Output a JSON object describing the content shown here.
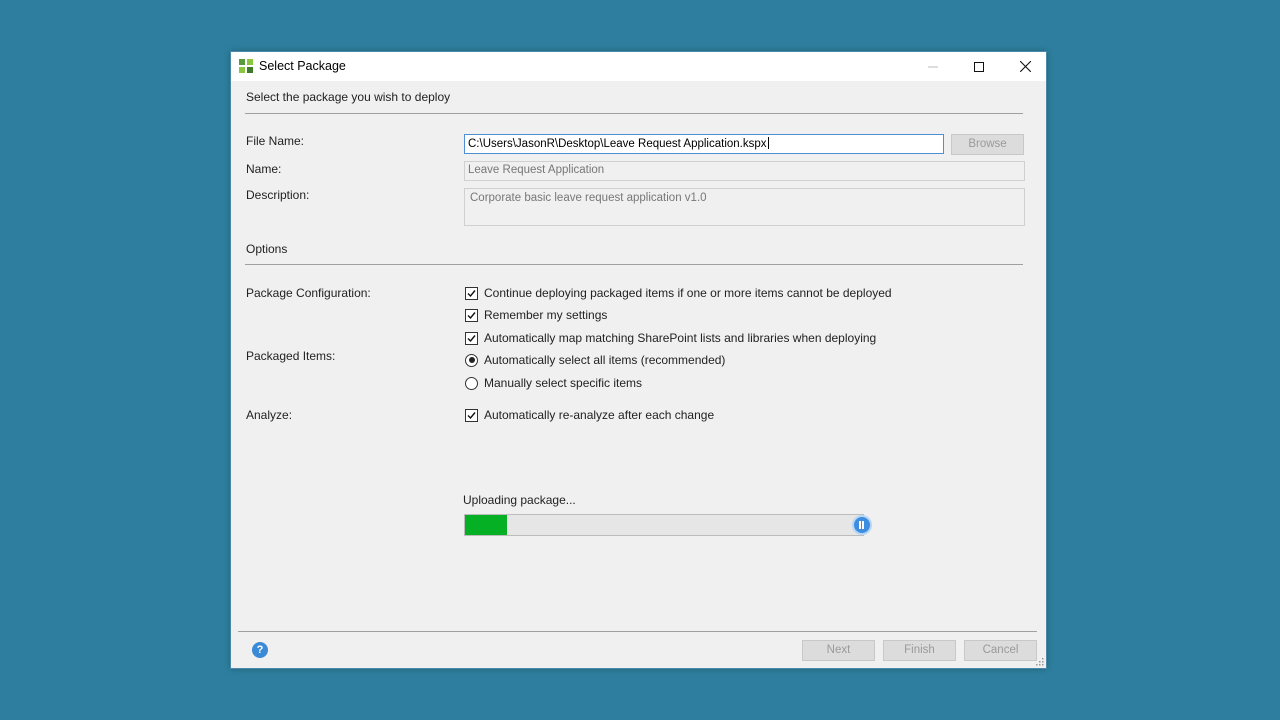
{
  "window": {
    "title": "Select Package"
  },
  "header": {
    "subtitle": "Select the package you wish to deploy"
  },
  "form": {
    "file_name_label": "File Name:",
    "file_name_value": "C:\\Users\\JasonR\\Desktop\\Leave Request Application.kspx",
    "browse_label": "Browse",
    "name_label": "Name:",
    "name_value": "Leave Request Application",
    "description_label": "Description:",
    "description_value": "Corporate basic leave request application v1.0"
  },
  "options": {
    "section_label": "Options",
    "package_config_label": "Package Configuration:",
    "packaged_items_label": "Packaged Items:",
    "analyze_label": "Analyze:",
    "continue_deploying": {
      "label": "Continue deploying packaged items if one or more items cannot be deployed",
      "checked": true
    },
    "remember_settings": {
      "label": "Remember my settings",
      "checked": true
    },
    "auto_map": {
      "label": "Automatically map matching SharePoint lists and libraries when deploying",
      "checked": true
    },
    "auto_select_all": {
      "label": "Automatically select all items (recommended)",
      "selected": true
    },
    "manual_select": {
      "label": "Manually select specific items",
      "selected": false
    },
    "auto_reanalyze": {
      "label": "Automatically re-analyze after each change",
      "checked": true
    }
  },
  "progress": {
    "status": "Uploading package...",
    "fraction": 0.105,
    "fill_color": "#06b025"
  },
  "footer": {
    "next_label": "Next",
    "finish_label": "Finish",
    "cancel_label": "Cancel",
    "help_symbol": "?"
  },
  "colors": {
    "desktop": "#2e7f9f",
    "dialog": "#f0f0f0",
    "accent": "#3a8ad6"
  }
}
